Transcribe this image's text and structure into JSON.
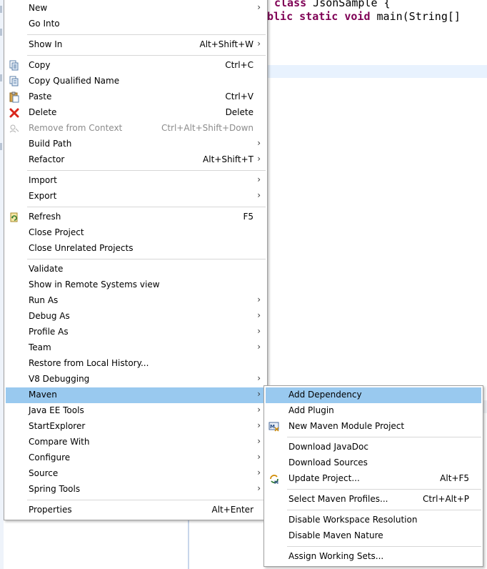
{
  "editor": {
    "line1_keyword": "class",
    "line1_rest": " JsonSample {",
    "line2_prefix": "blic ",
    "line2_keywords": [
      "static",
      "void"
    ],
    "line2_rest": " main(String[]"
  },
  "context_menu": {
    "items": [
      {
        "label": "New",
        "shortcut": "",
        "submenu": true
      },
      {
        "label": "Go Into",
        "shortcut": "",
        "submenu": false
      },
      {
        "label": "Show In",
        "shortcut": "Alt+Shift+W",
        "submenu": true
      },
      {
        "label": "Copy",
        "shortcut": "Ctrl+C",
        "icon": "copy-icon"
      },
      {
        "label": "Copy Qualified Name",
        "shortcut": "",
        "icon": "copy-qualified-name-icon"
      },
      {
        "label": "Paste",
        "shortcut": "Ctrl+V",
        "icon": "paste-icon"
      },
      {
        "label": "Delete",
        "shortcut": "Delete",
        "icon": "delete-icon"
      },
      {
        "label": "Remove from Context",
        "shortcut": "Ctrl+Alt+Shift+Down",
        "icon": "remove-from-context-icon",
        "disabled": true
      },
      {
        "label": "Build Path",
        "shortcut": "",
        "submenu": true
      },
      {
        "label": "Refactor",
        "shortcut": "Alt+Shift+T",
        "submenu": true
      },
      {
        "label": "Import",
        "shortcut": "",
        "submenu": true
      },
      {
        "label": "Export",
        "shortcut": "",
        "submenu": true
      },
      {
        "label": "Refresh",
        "shortcut": "F5",
        "icon": "refresh-icon"
      },
      {
        "label": "Close Project",
        "shortcut": ""
      },
      {
        "label": "Close Unrelated Projects",
        "shortcut": ""
      },
      {
        "label": "Validate",
        "shortcut": ""
      },
      {
        "label": "Show in Remote Systems view",
        "shortcut": ""
      },
      {
        "label": "Run As",
        "shortcut": "",
        "submenu": true
      },
      {
        "label": "Debug As",
        "shortcut": "",
        "submenu": true
      },
      {
        "label": "Profile As",
        "shortcut": "",
        "submenu": true
      },
      {
        "label": "Team",
        "shortcut": "",
        "submenu": true
      },
      {
        "label": "Restore from Local History...",
        "shortcut": ""
      },
      {
        "label": "V8 Debugging",
        "shortcut": "",
        "submenu": true
      },
      {
        "label": "Maven",
        "shortcut": "",
        "submenu": true,
        "selected": true
      },
      {
        "label": "Java EE Tools",
        "shortcut": "",
        "submenu": true
      },
      {
        "label": "StartExplorer",
        "shortcut": "",
        "submenu": true
      },
      {
        "label": "Compare With",
        "shortcut": "",
        "submenu": true
      },
      {
        "label": "Configure",
        "shortcut": "",
        "submenu": true
      },
      {
        "label": "Source",
        "shortcut": "",
        "submenu": true
      },
      {
        "label": "Spring Tools",
        "shortcut": "",
        "submenu": true
      },
      {
        "label": "Properties",
        "shortcut": "Alt+Enter"
      }
    ]
  },
  "maven_submenu": {
    "items": [
      {
        "label": "Add Dependency",
        "shortcut": "",
        "selected": true
      },
      {
        "label": "Add Plugin",
        "shortcut": ""
      },
      {
        "label": "New Maven Module Project",
        "shortcut": "",
        "icon": "maven-module-icon"
      },
      {
        "label": "Download JavaDoc",
        "shortcut": ""
      },
      {
        "label": "Download Sources",
        "shortcut": ""
      },
      {
        "label": "Update Project...",
        "shortcut": "Alt+F5",
        "icon": "maven-update-icon"
      },
      {
        "label": "Select Maven Profiles...",
        "shortcut": "Ctrl+Alt+P"
      },
      {
        "label": "Disable Workspace Resolution",
        "shortcut": ""
      },
      {
        "label": "Disable Maven Nature",
        "shortcut": ""
      },
      {
        "label": "Assign Working Sets...",
        "shortcut": ""
      }
    ]
  },
  "submenu_arrow": "›",
  "colors": {
    "selection": "#99c9ef",
    "keyword": "#7f0055",
    "disabled_text": "#8c8c8c",
    "line_highlight": "#e8f2fe"
  }
}
